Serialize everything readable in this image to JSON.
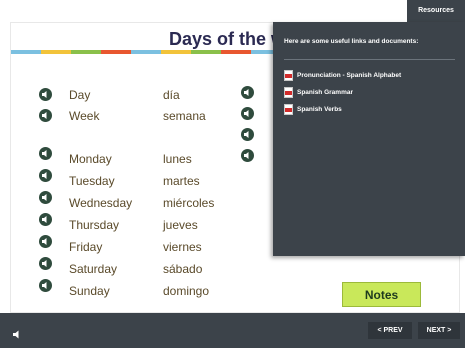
{
  "header": {
    "resources_tab": "Resources"
  },
  "slide": {
    "title": "Days of the w",
    "rows": [
      {
        "en": "Day",
        "es": "día"
      },
      {
        "en": "Week",
        "es": "semana"
      },
      {
        "en": "Monday",
        "es": "lunes"
      },
      {
        "en": "Tuesday",
        "es": "martes"
      },
      {
        "en": "Wednesday",
        "es": "miércoles"
      },
      {
        "en": "Thursday",
        "es": "jueves"
      },
      {
        "en": "Friday",
        "es": "viernes"
      },
      {
        "en": "Saturday",
        "es": "sábado"
      },
      {
        "en": "Sunday",
        "es": "domingo"
      }
    ],
    "notes_label": "Notes"
  },
  "resources": {
    "heading": "Here are some useful links and documents:",
    "links": [
      {
        "label": "Pronunciation - Spanish Alphabet",
        "icon": "pdf-icon"
      },
      {
        "label": "Spanish Grammar",
        "icon": "pdf-icon"
      },
      {
        "label": "Spanish Verbs",
        "icon": "pdf-icon"
      }
    ]
  },
  "footer": {
    "prev_label": "< PREV",
    "next_label": "NEXT >"
  },
  "colors": {
    "dark_bar": "#3c434a",
    "notes_green": "#c9e85a",
    "title_navy": "#2b2a52",
    "speaker_green": "#2f4b3d"
  }
}
